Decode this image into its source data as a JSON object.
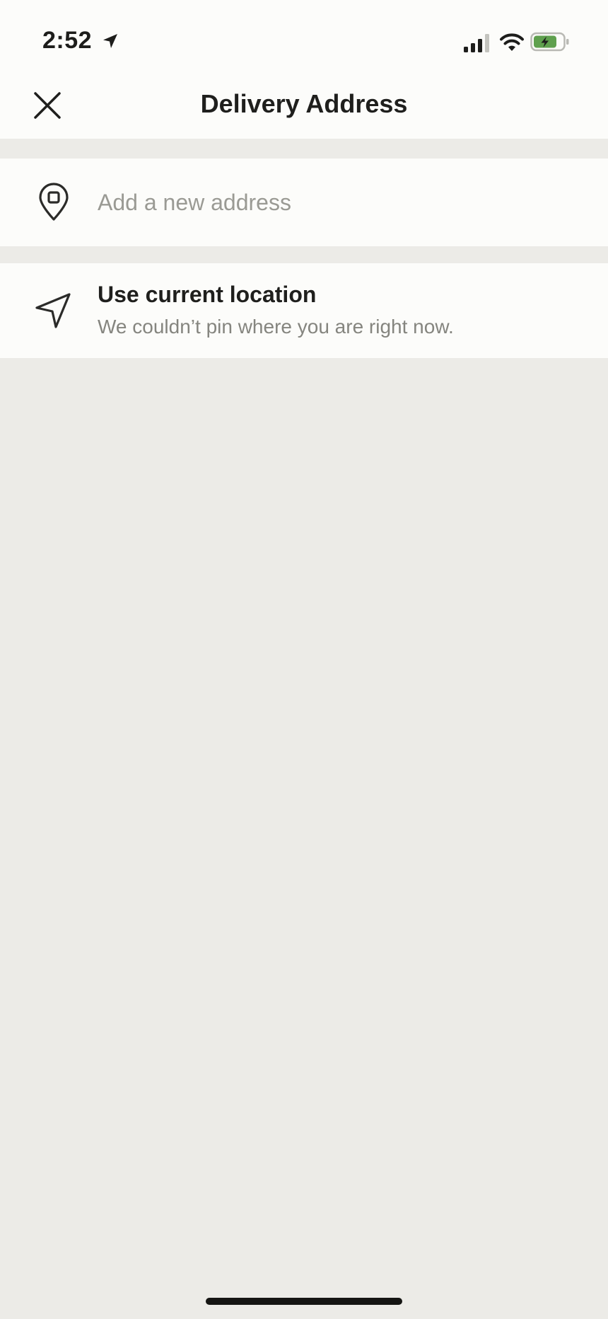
{
  "status_bar": {
    "time": "2:52",
    "icons": [
      "location-arrow-icon",
      "signal-icon",
      "wifi-icon",
      "battery-charging-icon"
    ],
    "battery_color": "#5fa04e"
  },
  "header": {
    "title": "Delivery Address",
    "close_icon": "close-icon"
  },
  "add_address": {
    "icon": "map-pin-icon",
    "placeholder": "Add a new address",
    "value": ""
  },
  "current_location": {
    "icon": "navigation-arrow-icon",
    "title": "Use current location",
    "subtitle": "We couldn’t pin where you are right now."
  },
  "colors": {
    "surface": "#fcfcfa",
    "background": "#ecebe7",
    "text_primary": "#1f1f1d",
    "text_secondary": "#85857f",
    "placeholder": "#9a9a94"
  }
}
